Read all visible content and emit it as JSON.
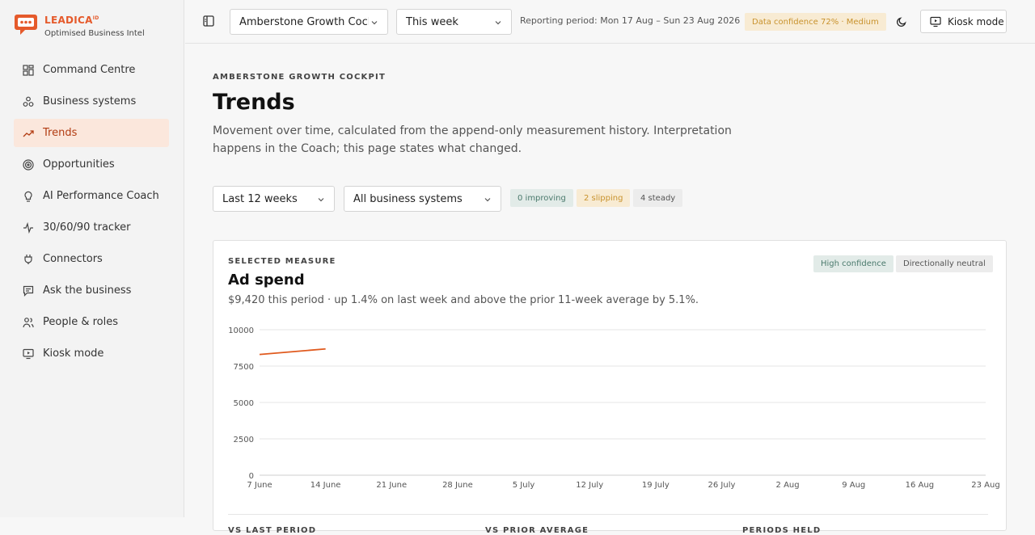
{
  "brand": {
    "name": "LEADICA",
    "mark": "ID",
    "tagline": "Optimised Business Intel"
  },
  "sidebar": {
    "items": [
      {
        "label": "Command Centre",
        "icon": "grid-icon",
        "active": false
      },
      {
        "label": "Business systems",
        "icon": "nodes-icon",
        "active": false
      },
      {
        "label": "Trends",
        "icon": "trend-up-icon",
        "active": true
      },
      {
        "label": "Opportunities",
        "icon": "target-icon",
        "active": false
      },
      {
        "label": "AI Performance Coach",
        "icon": "lightbulb-icon",
        "active": false
      },
      {
        "label": "30/60/90 tracker",
        "icon": "pulse-icon",
        "active": false
      },
      {
        "label": "Connectors",
        "icon": "plug-icon",
        "active": false
      },
      {
        "label": "Ask the business",
        "icon": "chat-icon",
        "active": false
      },
      {
        "label": "People & roles",
        "icon": "people-icon",
        "active": false
      },
      {
        "label": "Kiosk mode",
        "icon": "monitor-icon",
        "active": false
      }
    ]
  },
  "topbar": {
    "workspace": "Amberstone Growth Cockpit",
    "timeframe": "This week",
    "reporting_period": "Reporting period: Mon 17 Aug – Sun 23 Aug 2026",
    "data_confidence": "Data confidence 72% · Medium",
    "kiosk_label": "Kiosk mode"
  },
  "page": {
    "eyebrow": "AMBERSTONE GROWTH COCKPIT",
    "title": "Trends",
    "description": "Movement over time, calculated from the append-only measurement history. Interpretation happens in the Coach; this page states what changed."
  },
  "filters": {
    "range": "Last 12 weeks",
    "systems": "All business systems",
    "improving": "0 improving",
    "slipping": "2 slipping",
    "steady": "4 steady"
  },
  "card": {
    "eyebrow": "SELECTED MEASURE",
    "title": "Ad spend",
    "summary": "$9,420 this period · up 1.4% on last week and above the prior 11-week average by 5.1%.",
    "confidence_badge": "High confidence",
    "direction_badge": "Directionally neutral",
    "stats": [
      "VS LAST PERIOD",
      "VS PRIOR AVERAGE",
      "PERIODS HELD"
    ]
  },
  "colors": {
    "accent": "#e55a2b",
    "active_bg": "#fbe7dc",
    "line": "#e05a1e"
  },
  "chart_data": {
    "type": "line",
    "x": [
      "7 June",
      "14 June",
      "21 June",
      "28 June",
      "5 July",
      "12 July",
      "19 July",
      "26 July",
      "2 Aug",
      "9 Aug",
      "16 Aug",
      "23 Aug"
    ],
    "y_ticks": [
      "0",
      "2500",
      "5000",
      "7500",
      "10000"
    ],
    "ylim": [
      0,
      10000
    ],
    "series": [
      {
        "values": [
          8300,
          8680
        ]
      }
    ],
    "grid": true
  }
}
